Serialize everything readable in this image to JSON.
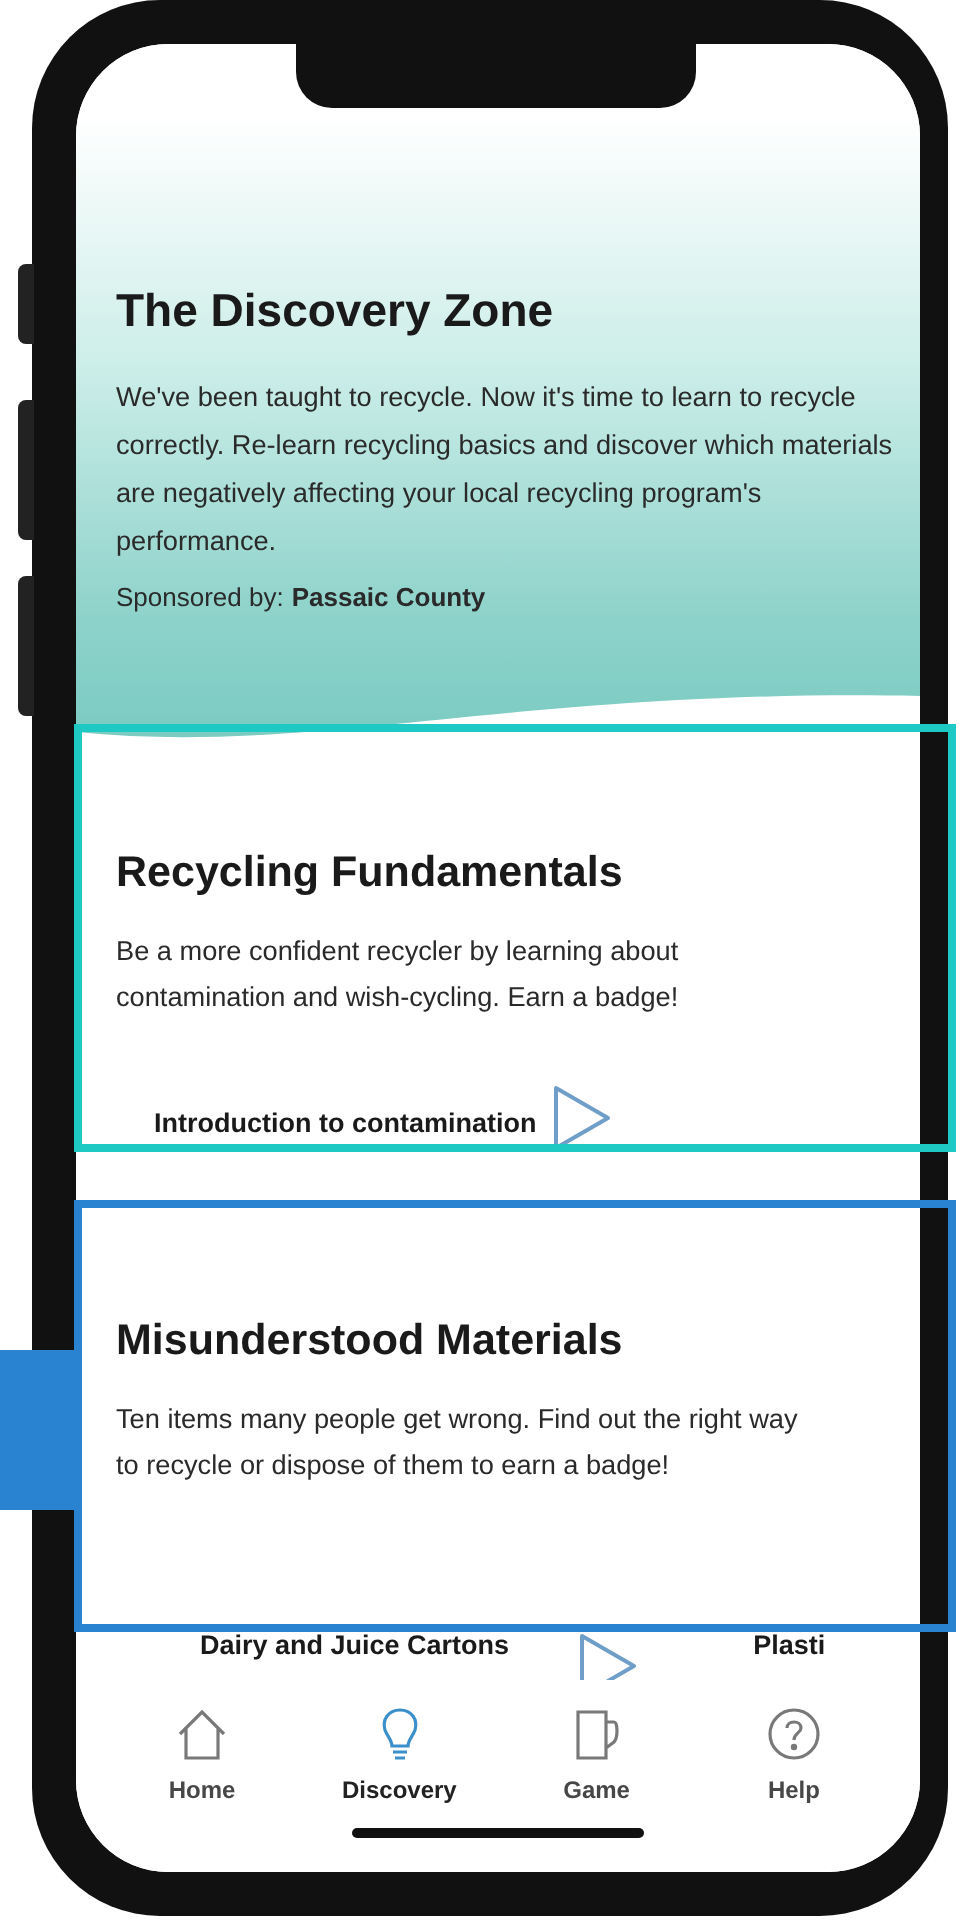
{
  "header": {
    "title": "The Discovery Zone",
    "description": "We've been taught to recycle. Now it's time to learn to recycle correctly. Re-learn recycling basics and discover which materials are negatively affecting your local recycling program's performance.",
    "sponsor_label": "Sponsored by:",
    "sponsor": "Passaic County"
  },
  "sections": [
    {
      "title": "Recycling Fundamentals",
      "description": "Be a more confident recycler by learning about contamination and wish-cycling. Earn a badge!",
      "color": "#1ec9c3",
      "lessons": [
        {
          "title": "Introduction to contamination"
        }
      ]
    },
    {
      "title": "Misunderstood Materials",
      "description": "Ten items many people get wrong. Find out the right way to recycle or dispose of them to earn a badge!",
      "color": "#2a83d1",
      "lessons": [
        {
          "title": "Dairy and Juice Cartons"
        },
        {
          "title": "Plasti"
        }
      ]
    }
  ],
  "nav": [
    {
      "label": "Home",
      "kind": "home",
      "selected": false
    },
    {
      "label": "Discovery",
      "kind": "discovery",
      "selected": true
    },
    {
      "label": "Game",
      "kind": "game",
      "selected": false
    },
    {
      "label": "Help",
      "kind": "help",
      "selected": false
    }
  ]
}
